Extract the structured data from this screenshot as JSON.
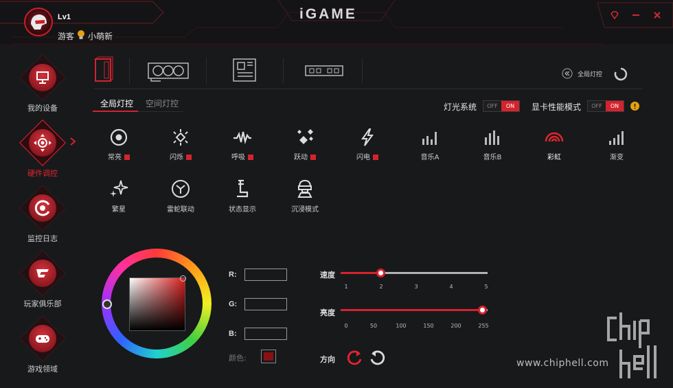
{
  "header": {
    "level": "Lv1",
    "role": "游客",
    "username": "小萌新",
    "logo": "iGAME",
    "buttons": [
      "gem-icon",
      "minimize-icon",
      "close-icon"
    ]
  },
  "sidebar": {
    "items": [
      {
        "label": "我的设备",
        "icon": "monitor-icon",
        "active": false
      },
      {
        "label": "硬件调控",
        "icon": "control-pad-icon",
        "active": true
      },
      {
        "label": "监控日志",
        "icon": "monitor-log-icon",
        "active": false
      },
      {
        "label": "玩家俱乐部",
        "icon": "club-icon",
        "active": false
      },
      {
        "label": "游戏领域",
        "icon": "gamepad-icon",
        "active": false
      }
    ]
  },
  "device_tabs": [
    "pc-case-icon",
    "graphics-card-icon",
    "motherboard-icon",
    "memory-icon"
  ],
  "global_light_button": "全局灯控",
  "subtabs": {
    "global": "全局灯控",
    "space": "空间灯控"
  },
  "toggles": {
    "light_system": {
      "label": "灯光系统",
      "off": "OFF",
      "on": "ON"
    },
    "gpu_mode": {
      "label": "显卡性能模式",
      "off": "OFF",
      "on": "ON"
    }
  },
  "effects": [
    {
      "label": "常亮",
      "icon": "target-icon",
      "marker": true
    },
    {
      "label": "闪烁",
      "icon": "blink-icon",
      "marker": true
    },
    {
      "label": "呼吸",
      "icon": "breath-wave-icon",
      "marker": true
    },
    {
      "label": "跃动",
      "icon": "bounce-icon",
      "marker": true
    },
    {
      "label": "闪电",
      "icon": "lightning-icon",
      "marker": true
    },
    {
      "label": "音乐A",
      "icon": "music-bars-a-icon",
      "marker": false
    },
    {
      "label": "音乐B",
      "icon": "music-bars-b-icon",
      "marker": false
    },
    {
      "label": "彩虹",
      "icon": "rainbow-icon",
      "marker": false,
      "active": true
    },
    {
      "label": "渐变",
      "icon": "gradient-bars-icon",
      "marker": false
    },
    {
      "label": "繁星",
      "icon": "stars-icon",
      "marker": false
    },
    {
      "label": "雷蛇联动",
      "icon": "razer-sync-icon",
      "marker": false
    },
    {
      "label": "状态显示",
      "icon": "status-icon",
      "marker": false
    },
    {
      "label": "沉浸模式",
      "icon": "immersive-icon",
      "marker": false
    }
  ],
  "color": {
    "r_label": "R:",
    "g_label": "G:",
    "b_label": "B:",
    "r_value": "",
    "g_value": "",
    "b_value": "",
    "swatch_label": "颜色:",
    "swatch_color": "#8a1016"
  },
  "speed": {
    "label": "速度",
    "ticks": [
      "1",
      "2",
      "3",
      "4",
      "5"
    ],
    "value": 2,
    "min": 1,
    "max": 5
  },
  "brightness": {
    "label": "亮度",
    "ticks": [
      "0",
      "50",
      "100",
      "150",
      "200",
      "255"
    ],
    "value": 255,
    "min": 0,
    "max": 255
  },
  "direction": {
    "label": "方向",
    "icons": [
      "rotate-clockwise-icon",
      "rotate-counterclockwise-icon"
    ]
  },
  "watermark": {
    "logo": "chip hell",
    "url": "www.chiphell.com"
  },
  "colors": {
    "accent": "#d5232e",
    "background": "#18191b",
    "warning": "#e8a010"
  }
}
